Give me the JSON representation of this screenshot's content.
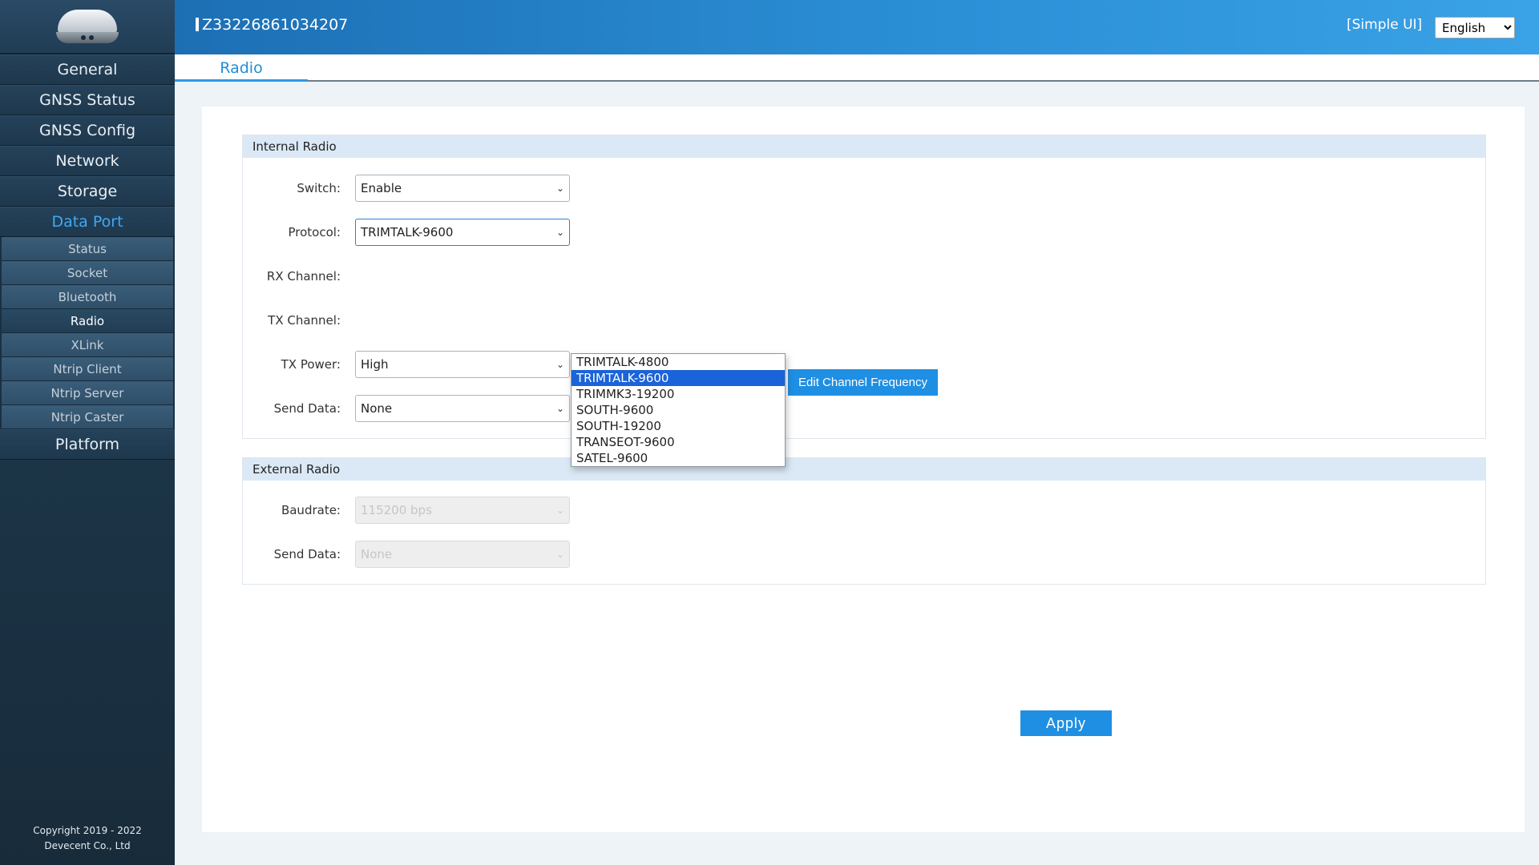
{
  "header": {
    "device_id": "Z33226861034207",
    "simple_ui_label": "[Simple UI]",
    "language": "English"
  },
  "sidebar": {
    "items": [
      {
        "label": "General"
      },
      {
        "label": "GNSS Status"
      },
      {
        "label": "GNSS Config"
      },
      {
        "label": "Network"
      },
      {
        "label": "Storage"
      },
      {
        "label": "Data Port"
      }
    ],
    "data_port_sub": [
      {
        "label": "Status"
      },
      {
        "label": "Socket"
      },
      {
        "label": "Bluetooth"
      },
      {
        "label": "Radio"
      },
      {
        "label": "XLink"
      },
      {
        "label": "Ntrip Client"
      },
      {
        "label": "Ntrip Server"
      },
      {
        "label": "Ntrip Caster"
      }
    ],
    "platform": "Platform",
    "copyright_line1": "Copyright 2019 - 2022",
    "copyright_line2": "Devecent Co., Ltd"
  },
  "tab": {
    "label": "Radio"
  },
  "internal_radio": {
    "title": "Internal Radio",
    "switch_label": "Switch:",
    "switch_value": "Enable",
    "protocol_label": "Protocol:",
    "protocol_value": "TRIMTALK-9600",
    "rx_label": "RX Channel:",
    "tx_label": "TX Channel:",
    "power_label": "TX Power:",
    "power_value": "High",
    "send_label": "Send Data:",
    "send_value": "None",
    "edit_button": "Edit Channel Frequency"
  },
  "protocol_options": [
    "TRIMTALK-4800",
    "TRIMTALK-9600",
    "TRIMMK3-19200",
    "SOUTH-9600",
    "SOUTH-19200",
    "TRANSEOT-9600",
    "SATEL-9600"
  ],
  "external_radio": {
    "title": "External Radio",
    "baud_label": "Baudrate:",
    "baud_value": "115200 bps",
    "send_label": "Send Data:",
    "send_value": "None"
  },
  "apply_label": "Apply",
  "colors": {
    "accent": "#1f8fe3",
    "header_start": "#1d6fb4",
    "header_end": "#3aa2e6",
    "sidebar_bg": "#1f3b52",
    "selected_option": "#1b63d8"
  }
}
